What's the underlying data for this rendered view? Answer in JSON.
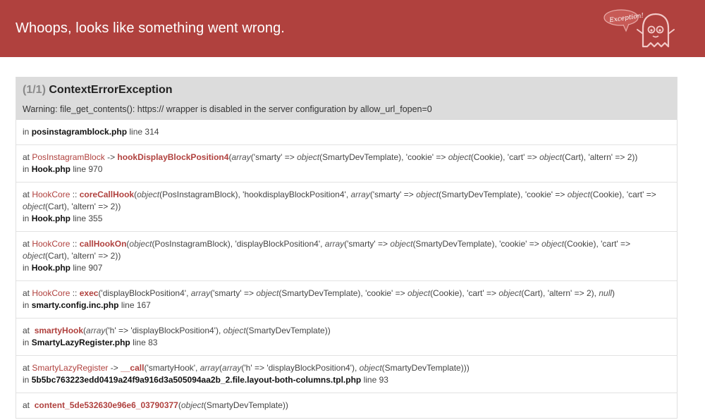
{
  "header": {
    "title": "Whoops, looks like something went wrong.",
    "mascot_label": "Exception!",
    "color": "#b0413e"
  },
  "exception": {
    "counter": "(1/1)",
    "name": "ContextErrorException",
    "message": "Warning: file_get_contents(): https:// wrapper is disabled in the server configuration by allow_url_fopen=0"
  },
  "trace": [
    {
      "file_prefix": "in ",
      "file": "posinstagramblock.php",
      "line": " line 314"
    },
    {
      "at": "at ",
      "class": "PosInstagramBlock",
      "sep": " -> ",
      "func": "hookDisplayBlockPosition4",
      "args_open": "(",
      "a1": "array",
      "a1t": "('smarty' => ",
      "a2": "object",
      "a2t": "(SmartyDevTemplate), 'cookie' => ",
      "a3": "object",
      "a3t": "(Cookie), 'cart' => ",
      "a4": "object",
      "a4t": "(Cart), 'altern' => 2))",
      "file_prefix": "in ",
      "file": "Hook.php",
      "line": " line 970"
    },
    {
      "at": "at ",
      "class": "HookCore",
      "sep": " :: ",
      "func": "coreCallHook",
      "args_open": "(",
      "a1": "object",
      "a1t": "(PosInstagramBlock), 'hookdisplayBlockPosition4', ",
      "a2": "array",
      "a2t": "('smarty' => ",
      "a3": "object",
      "a3t": "(SmartyDevTemplate), 'cookie' => ",
      "a4": "object",
      "a4t": "(Cookie), 'cart' => ",
      "a5": "object",
      "a5t": "(Cart), 'altern' => 2))",
      "file_prefix": "in ",
      "file": "Hook.php",
      "line": " line 355"
    },
    {
      "at": "at ",
      "class": "HookCore",
      "sep": " :: ",
      "func": "callHookOn",
      "args_open": "(",
      "a1": "object",
      "a1t": "(PosInstagramBlock), 'displayBlockPosition4', ",
      "a2": "array",
      "a2t": "('smarty' => ",
      "a3": "object",
      "a3t": "(SmartyDevTemplate), 'cookie' => ",
      "a4": "object",
      "a4t": "(Cookie), 'cart' => ",
      "a5": "object",
      "a5t": "(Cart), 'altern' => 2))",
      "file_prefix": "in ",
      "file": "Hook.php",
      "line": " line 907"
    },
    {
      "at": "at ",
      "class": "HookCore",
      "sep": " :: ",
      "func": "exec",
      "args_open": "(",
      "a1t0": "'displayBlockPosition4', ",
      "a1": "array",
      "a1t": "('smarty' => ",
      "a2": "object",
      "a2t": "(SmartyDevTemplate), 'cookie' => ",
      "a3": "object",
      "a3t": "(Cookie), 'cart' => ",
      "a4": "object",
      "a4t": "(Cart), 'altern' => 2), ",
      "a5": "null",
      "a5t": ")",
      "file_prefix": "in ",
      "file": "smarty.config.inc.php",
      "line": " line 167"
    },
    {
      "at": "at ",
      "func": "smartyHook",
      "args_open": "(",
      "a1": "array",
      "a1t": "('h' => 'displayBlockPosition4'), ",
      "a2": "object",
      "a2t": "(SmartyDevTemplate))",
      "file_prefix": "in ",
      "file": "SmartyLazyRegister.php",
      "line": " line 83"
    },
    {
      "at": "at ",
      "class": "SmartyLazyRegister",
      "sep": " -> ",
      "func": "__call",
      "args_open": "(",
      "a1t0": "'smartyHook', ",
      "a1": "array",
      "a1t": "(",
      "a2": "array",
      "a2t": "('h' => 'displayBlockPosition4'), ",
      "a3": "object",
      "a3t": "(SmartyDevTemplate)))",
      "file_prefix": "in ",
      "file": "5b5bc763223edd0419a24f9a916d3a505094aa2b_2.file.layout-both-columns.tpl.php",
      "line": " line 93"
    },
    {
      "at": "at ",
      "func": "content_5de532630e96e6_03790377",
      "args_open": "(",
      "a1": "object",
      "a1t": "(SmartyDevTemplate))"
    }
  ]
}
